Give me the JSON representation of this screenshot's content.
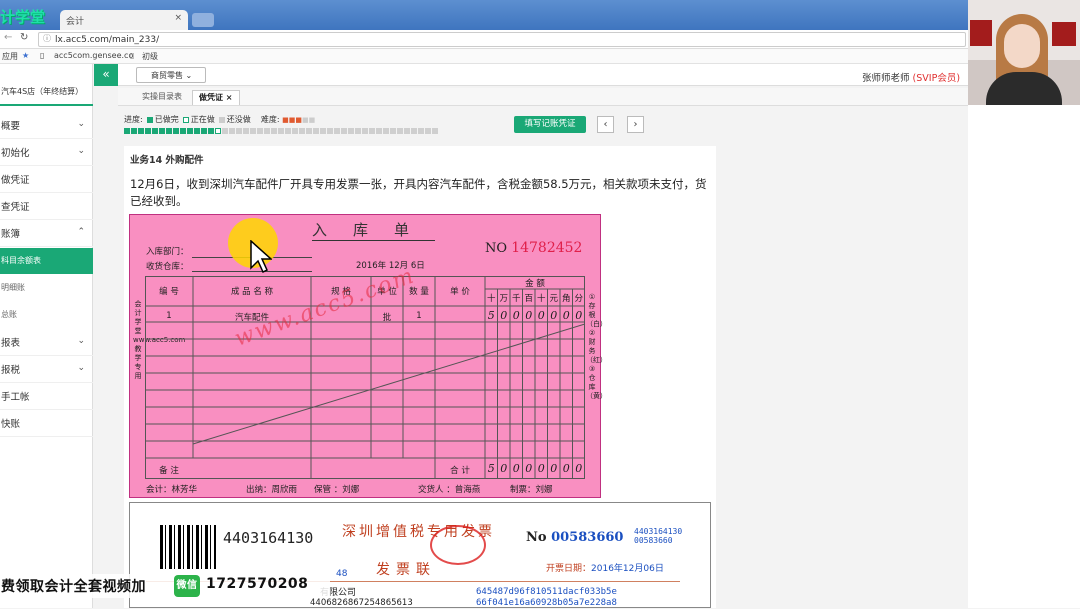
{
  "browser": {
    "logo": "计学堂",
    "tab_title": "会计",
    "tab_close": "×",
    "url": "lx.acc5.com/main_233/",
    "bookmarks": [
      "应用",
      "acc5com.gensee.co",
      "初级"
    ]
  },
  "sidebar": {
    "store": "汽车4S店（年终结算）",
    "items": [
      {
        "label": "概要"
      },
      {
        "label": "初始化"
      },
      {
        "label": "做凭证"
      },
      {
        "label": "查凭证"
      },
      {
        "label": "账簿"
      },
      {
        "label": "科目余额表"
      },
      {
        "label": "明细账"
      },
      {
        "label": "总账"
      },
      {
        "label": "报表"
      },
      {
        "label": "报税"
      },
      {
        "label": "手工帐"
      },
      {
        "label": "快账"
      }
    ]
  },
  "topbar": {
    "collapse": "«",
    "dropdown": "商贸零售",
    "teacher": "张师师老师",
    "vip": "(SVIP会员)"
  },
  "subtabs": {
    "catalog": "实操目录表",
    "voucher": "做凭证",
    "close": "×"
  },
  "progress": {
    "label": "进度:",
    "done": "已做完",
    "doing": "正在做",
    "todo": "还没做",
    "difficulty": "难度:",
    "fill_button": "填写记账凭证",
    "prev": "‹",
    "next": "›"
  },
  "task": {
    "title": "业务14 外购配件",
    "desc": "12月6日，收到深圳汽车配件厂开具专用发票一张，开具内容汽车配件，含税金额58.5万元，相关款项未支付，货已经收到。"
  },
  "receipt": {
    "title": "入库单",
    "dept_label": "入库部门：",
    "warehouse_label": "收货仓库：",
    "date": "2016年  12月 6日",
    "no_label": "NO",
    "no": "14782452",
    "headers": {
      "code": "编 号",
      "name": "成 品 名 称",
      "spec": "规 格",
      "unit": "单 位",
      "qty": "数 量",
      "price": "单 价",
      "amount": "金   额"
    },
    "digit_headers": [
      "十",
      "万",
      "千",
      "百",
      "十",
      "元",
      "角",
      "分"
    ],
    "row": {
      "code": "1",
      "name": "汽车配件",
      "unit": "批",
      "qty": "1",
      "digits": [
        "5",
        "0",
        "0",
        "0",
        "0",
        "0",
        "0",
        "0"
      ]
    },
    "total_label": "合 计",
    "total_digits": [
      "5",
      "0",
      "0",
      "0",
      "0",
      "0",
      "0",
      "0"
    ],
    "remark": "备 注",
    "left_side": "会计学堂www.acc5.com教学专用",
    "right_side": "①存根（白）②财务（红）③仓库（黄）",
    "footer": {
      "accountant": "会计：林芳华",
      "cashier": "出纳：周欣雨",
      "keeper": "保管 ：刘娜",
      "deliverer": "交货人 ：曾海燕",
      "maker": "制票：刘娜"
    },
    "watermark": "www.acc5.com"
  },
  "invoice": {
    "code": "4403164130",
    "title": "深圳增值税专用发票",
    "subtitle": "发票联",
    "no_label": "No",
    "no": "00583660",
    "code_small": [
      "4403164130",
      "00583660"
    ],
    "date_label": "开票日期：",
    "date": "2016年12月06日",
    "company": "有限公司",
    "company_prefix": "48",
    "tax_line": "4406826867254865613",
    "hash": [
      "645487d96f810511dacf033b5e",
      "66f041e16a60928b05a7e228a8"
    ]
  },
  "overlay": {
    "promo": "费领取会计全套视频加",
    "wechat": "微信",
    "promo_num": "1727570208"
  }
}
